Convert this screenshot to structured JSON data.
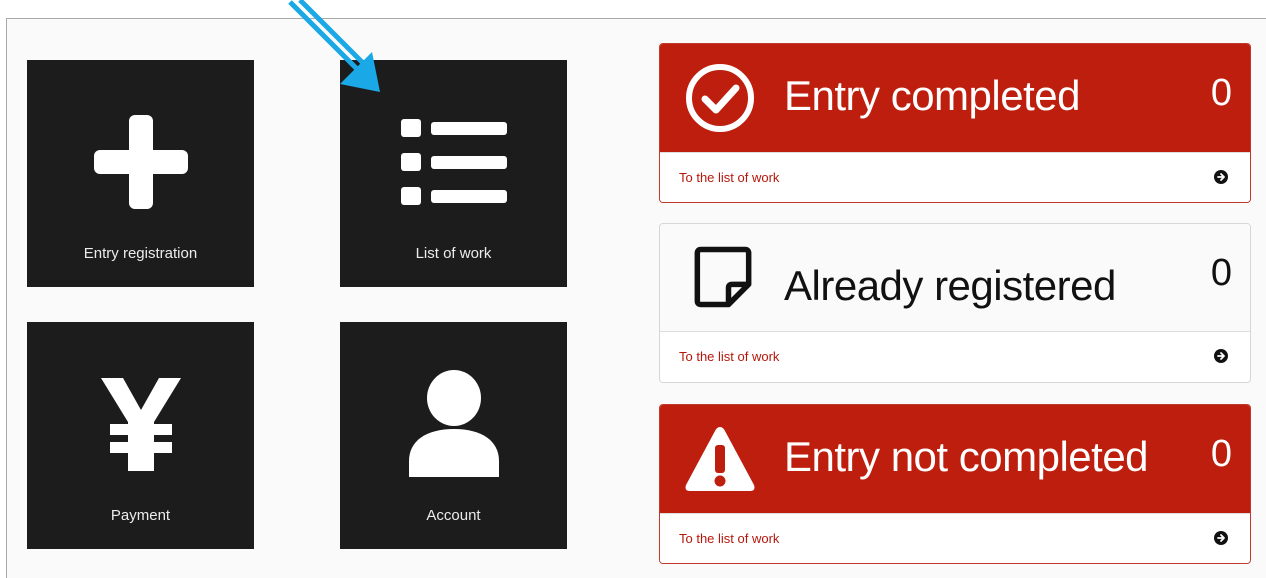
{
  "tiles": [
    {
      "label": "Entry registration",
      "icon": "plus-icon"
    },
    {
      "label": "List of work",
      "icon": "list-icon"
    },
    {
      "label": "Payment",
      "icon": "yen-icon"
    },
    {
      "label": "Account",
      "icon": "user-icon"
    }
  ],
  "panels": {
    "completed": {
      "title": "Entry completed",
      "count": "0",
      "link": "To the list of work",
      "icon": "check-circle-icon"
    },
    "registered": {
      "title": "Already registered",
      "count": "0",
      "link": "To the list of work",
      "icon": "sticky-note-icon"
    },
    "not_completed": {
      "title": "Entry not completed",
      "count": "0",
      "link": "To the list of work",
      "icon": "warning-icon"
    }
  },
  "colors": {
    "accent_red": "#be1e0d",
    "tile_bg": "#1c1c1c",
    "pointer": "#1aa9e6"
  }
}
